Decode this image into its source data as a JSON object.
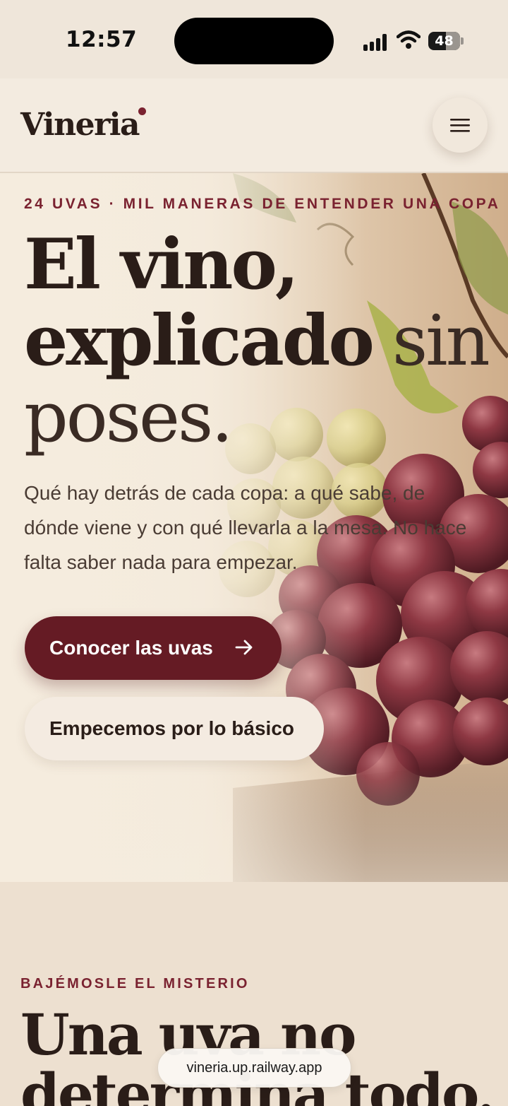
{
  "status_bar": {
    "time": "12:57",
    "battery": "48",
    "icons": [
      "signal-icon",
      "wifi-icon",
      "battery-icon"
    ]
  },
  "header": {
    "logo": "Vineria",
    "menu_icon": "hamburger-menu-icon"
  },
  "hero": {
    "eyebrow": "24 UVAS · MIL MANERAS DE ENTENDER UNA COPA",
    "title_line1": "El vino,",
    "title_line2_bold": "explicado",
    "title_line2_light": " sin",
    "title_line3": "poses.",
    "description": "Qué hay detrás de cada copa: a qué sabe, de dónde viene y con qué llevarla a la mesa. No hace falta saber nada para empezar.",
    "primary_button": "Conocer las uvas",
    "primary_button_icon": "arrow-right-icon",
    "secondary_button": "Empecemos por lo básico"
  },
  "section_two": {
    "eyebrow": "BAJÉMOSLE EL MISTERIO",
    "title": "Una uva no determina todo."
  },
  "browser": {
    "url": "vineria.up.railway.app"
  },
  "colors": {
    "accent": "#7a2230",
    "primary_button": "#651b24",
    "background": "#ede0d0"
  }
}
